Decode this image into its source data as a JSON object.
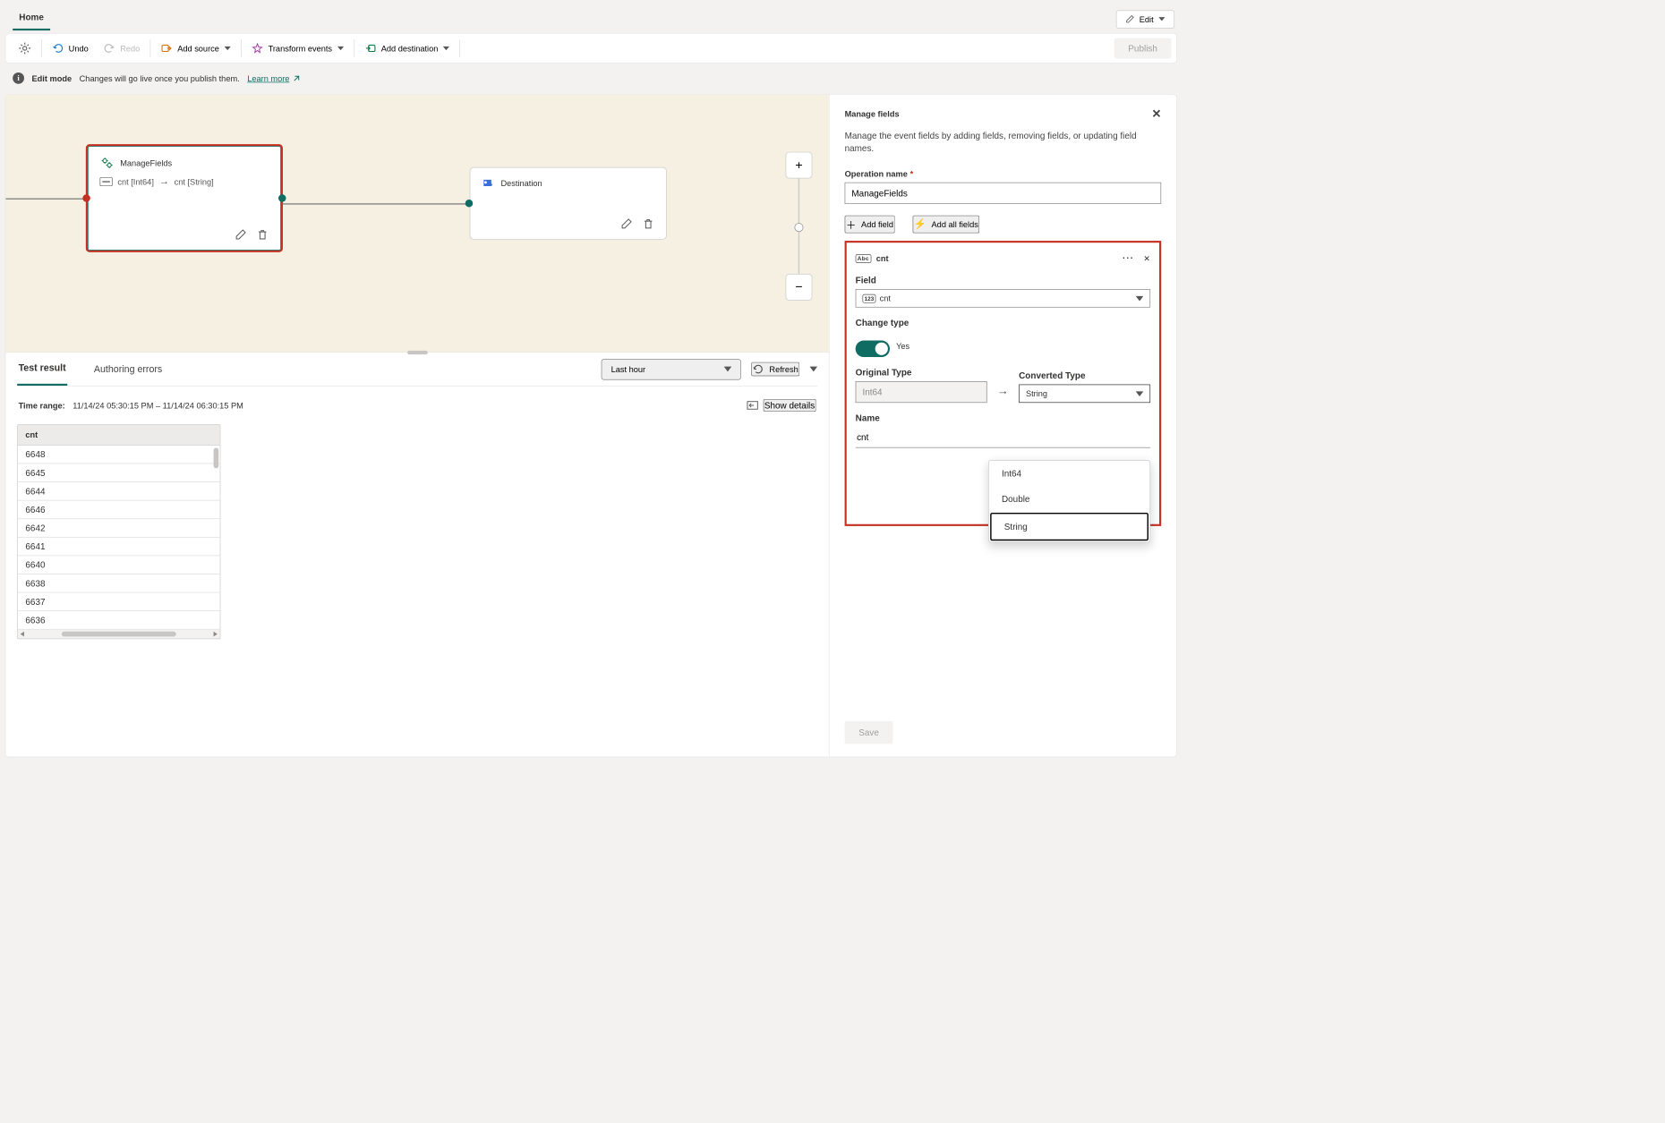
{
  "header": {
    "tab_home": "Home",
    "edit_btn": "Edit"
  },
  "toolbar": {
    "undo": "Undo",
    "redo": "Redo",
    "add_source": "Add source",
    "transform": "Transform events",
    "add_dest": "Add destination",
    "publish": "Publish"
  },
  "info_bar": {
    "mode": "Edit mode",
    "msg": "Changes will go live once you publish them.",
    "learn": "Learn more"
  },
  "canvas": {
    "mf_node": {
      "title": "ManageFields",
      "map_from": "cnt [Int64]",
      "map_to": "cnt [String]"
    },
    "dest_node": {
      "title": "Destination"
    }
  },
  "lower": {
    "tabs": {
      "test_result": "Test result",
      "authoring_errors": "Authoring errors"
    },
    "range_dropdown": "Last hour",
    "refresh": "Refresh",
    "time_label": "Time range:",
    "time_value": "11/14/24 05:30:15 PM  –  11/14/24 06:30:15 PM",
    "show_details": "Show details",
    "grid_col": "cnt",
    "grid_rows": [
      "6648",
      "6645",
      "6644",
      "6646",
      "6642",
      "6641",
      "6640",
      "6638",
      "6637",
      "6636"
    ]
  },
  "panel": {
    "title": "Manage fields",
    "subtitle": "Manage the event fields by adding fields, removing fields, or updating field names.",
    "op_label": "Operation name",
    "op_value": "ManageFields",
    "add_field": "Add field",
    "add_all": "Add all fields",
    "field_chip_label": "cnt",
    "field_label": "Field",
    "field_value": "cnt",
    "change_type_label": "Change type",
    "change_type_yes": "Yes",
    "orig_type_label": "Original Type",
    "orig_type_value": "Int64",
    "conv_type_label": "Converted Type",
    "conv_type_value": "String",
    "name_label": "Name",
    "name_value": "cnt",
    "dd_options": [
      "Int64",
      "Double",
      "String"
    ],
    "save_btn": "Save"
  }
}
